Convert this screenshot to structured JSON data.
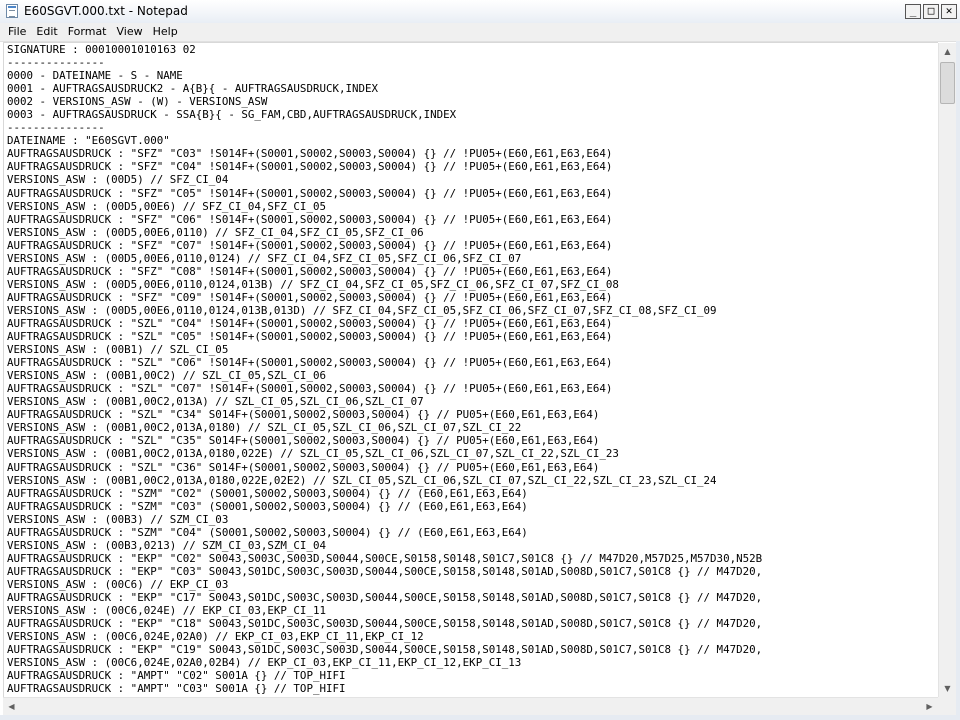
{
  "window": {
    "title": "E60SGVT.000.txt - Notepad",
    "buttons": {
      "minimize": "_",
      "maximize": "□",
      "close": "✕"
    }
  },
  "menu": {
    "items": [
      {
        "label": "File"
      },
      {
        "label": "Edit"
      },
      {
        "label": "Format"
      },
      {
        "label": "View"
      },
      {
        "label": "Help"
      }
    ]
  },
  "editor": {
    "lines": [
      "SIGNATURE : 00010001010163 02",
      "---------------",
      "0000 - DATEINAME - S - NAME",
      "0001 - AUFTRAGSAUSDRUCK2 - A{B}{ - AUFTRAGSAUSDRUCK,INDEX",
      "0002 - VERSIONS_ASW - (W) - VERSIONS_ASW",
      "0003 - AUFTRAGSAUSDRUCK - SSA{B}{ - SG_FAM,CBD,AUFTRAGSAUSDRUCK,INDEX",
      "---------------",
      "DATEINAME : \"E60SGVT.000\"",
      "AUFTRAGSAUSDRUCK : \"SFZ\" \"C03\" !S014F+(S0001,S0002,S0003,S0004) {} // !PU05+(E60,E61,E63,E64)",
      "AUFTRAGSAUSDRUCK : \"SFZ\" \"C04\" !S014F+(S0001,S0002,S0003,S0004) {} // !PU05+(E60,E61,E63,E64)",
      "VERSIONS_ASW : (00D5) // SFZ_CI_04",
      "AUFTRAGSAUSDRUCK : \"SFZ\" \"C05\" !S014F+(S0001,S0002,S0003,S0004) {} // !PU05+(E60,E61,E63,E64)",
      "VERSIONS_ASW : (00D5,00E6) // SFZ_CI_04,SFZ_CI_05",
      "AUFTRAGSAUSDRUCK : \"SFZ\" \"C06\" !S014F+(S0001,S0002,S0003,S0004) {} // !PU05+(E60,E61,E63,E64)",
      "VERSIONS_ASW : (00D5,00E6,0110) // SFZ_CI_04,SFZ_CI_05,SFZ_CI_06",
      "AUFTRAGSAUSDRUCK : \"SFZ\" \"C07\" !S014F+(S0001,S0002,S0003,S0004) {} // !PU05+(E60,E61,E63,E64)",
      "VERSIONS_ASW : (00D5,00E6,0110,0124) // SFZ_CI_04,SFZ_CI_05,SFZ_CI_06,SFZ_CI_07",
      "AUFTRAGSAUSDRUCK : \"SFZ\" \"C08\" !S014F+(S0001,S0002,S0003,S0004) {} // !PU05+(E60,E61,E63,E64)",
      "VERSIONS_ASW : (00D5,00E6,0110,0124,013B) // SFZ_CI_04,SFZ_CI_05,SFZ_CI_06,SFZ_CI_07,SFZ_CI_08",
      "AUFTRAGSAUSDRUCK : \"SFZ\" \"C09\" !S014F+(S0001,S0002,S0003,S0004) {} // !PU05+(E60,E61,E63,E64)",
      "VERSIONS_ASW : (00D5,00E6,0110,0124,013B,013D) // SFZ_CI_04,SFZ_CI_05,SFZ_CI_06,SFZ_CI_07,SFZ_CI_08,SFZ_CI_09",
      "AUFTRAGSAUSDRUCK : \"SZL\" \"C04\" !S014F+(S0001,S0002,S0003,S0004) {} // !PU05+(E60,E61,E63,E64)",
      "AUFTRAGSAUSDRUCK : \"SZL\" \"C05\" !S014F+(S0001,S0002,S0003,S0004) {} // !PU05+(E60,E61,E63,E64)",
      "VERSIONS_ASW : (00B1) // SZL_CI_05",
      "AUFTRAGSAUSDRUCK : \"SZL\" \"C06\" !S014F+(S0001,S0002,S0003,S0004) {} // !PU05+(E60,E61,E63,E64)",
      "VERSIONS_ASW : (00B1,00C2) // SZL_CI_05,SZL_CI_06",
      "AUFTRAGSAUSDRUCK : \"SZL\" \"C07\" !S014F+(S0001,S0002,S0003,S0004) {} // !PU05+(E60,E61,E63,E64)",
      "VERSIONS_ASW : (00B1,00C2,013A) // SZL_CI_05,SZL_CI_06,SZL_CI_07",
      "AUFTRAGSAUSDRUCK : \"SZL\" \"C34\" S014F+(S0001,S0002,S0003,S0004) {} // PU05+(E60,E61,E63,E64)",
      "VERSIONS_ASW : (00B1,00C2,013A,0180) // SZL_CI_05,SZL_CI_06,SZL_CI_07,SZL_CI_22",
      "AUFTRAGSAUSDRUCK : \"SZL\" \"C35\" S014F+(S0001,S0002,S0003,S0004) {} // PU05+(E60,E61,E63,E64)",
      "VERSIONS_ASW : (00B1,00C2,013A,0180,022E) // SZL_CI_05,SZL_CI_06,SZL_CI_07,SZL_CI_22,SZL_CI_23",
      "AUFTRAGSAUSDRUCK : \"SZL\" \"C36\" S014F+(S0001,S0002,S0003,S0004) {} // PU05+(E60,E61,E63,E64)",
      "VERSIONS_ASW : (00B1,00C2,013A,0180,022E,02E2) // SZL_CI_05,SZL_CI_06,SZL_CI_07,SZL_CI_22,SZL_CI_23,SZL_CI_24",
      "AUFTRAGSAUSDRUCK : \"SZM\" \"C02\" (S0001,S0002,S0003,S0004) {} // (E60,E61,E63,E64)",
      "AUFTRAGSAUSDRUCK : \"SZM\" \"C03\" (S0001,S0002,S0003,S0004) {} // (E60,E61,E63,E64)",
      "VERSIONS_ASW : (00B3) // SZM_CI_03",
      "AUFTRAGSAUSDRUCK : \"SZM\" \"C04\" (S0001,S0002,S0003,S0004) {} // (E60,E61,E63,E64)",
      "VERSIONS_ASW : (00B3,0213) // SZM_CI_03,SZM_CI_04",
      "AUFTRAGSAUSDRUCK : \"EKP\" \"C02\" S0043,S003C,S003D,S0044,S00CE,S0158,S0148,S01C7,S01C8 {} // M47D20,M57D25,M57D30,N52B",
      "AUFTRAGSAUSDRUCK : \"EKP\" \"C03\" S0043,S01DC,S003C,S003D,S0044,S00CE,S0158,S0148,S01AD,S008D,S01C7,S01C8 {} // M47D20,",
      "VERSIONS_ASW : (00C6) // EKP_CI_03",
      "AUFTRAGSAUSDRUCK : \"EKP\" \"C17\" S0043,S01DC,S003C,S003D,S0044,S00CE,S0158,S0148,S01AD,S008D,S01C7,S01C8 {} // M47D20,",
      "VERSIONS_ASW : (00C6,024E) // EKP_CI_03,EKP_CI_11",
      "AUFTRAGSAUSDRUCK : \"EKP\" \"C18\" S0043,S01DC,S003C,S003D,S0044,S00CE,S0158,S0148,S01AD,S008D,S01C7,S01C8 {} // M47D20,",
      "VERSIONS_ASW : (00C6,024E,02A0) // EKP_CI_03,EKP_CI_11,EKP_CI_12",
      "AUFTRAGSAUSDRUCK : \"EKP\" \"C19\" S0043,S01DC,S003C,S003D,S0044,S00CE,S0158,S0148,S01AD,S008D,S01C7,S01C8 {} // M47D20,",
      "VERSIONS_ASW : (00C6,024E,02A0,02B4) // EKP_CI_03,EKP_CI_11,EKP_CI_12,EKP_CI_13",
      "AUFTRAGSAUSDRUCK : \"AMPT\" \"C02\" S001A {} // TOP_HIFI",
      "AUFTRAGSAUSDRUCK : \"AMPT\" \"C03\" S001A {} // TOP_HIFI"
    ]
  },
  "scrollbars": {
    "up_arrow": "▲",
    "down_arrow": "▼",
    "left_arrow": "◀",
    "right_arrow": "▶"
  }
}
